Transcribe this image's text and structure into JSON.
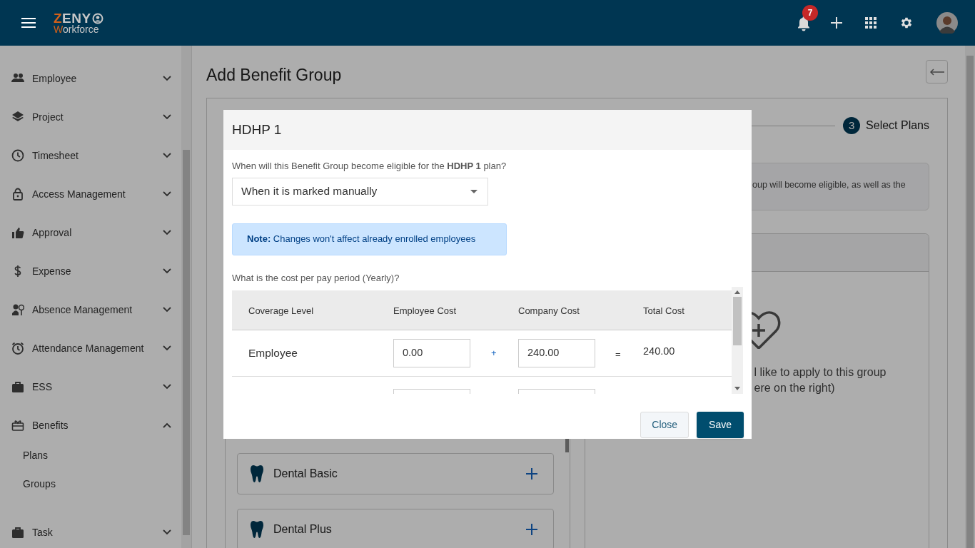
{
  "header": {
    "brand": {
      "accent": "Z",
      "rest": "ENY"
    },
    "tagline": {
      "accent": "W",
      "rest": "orkforce"
    },
    "notification_count": "7"
  },
  "sidebar": {
    "items": [
      {
        "label": "Employee",
        "expanded": false
      },
      {
        "label": "Project",
        "expanded": false
      },
      {
        "label": "Timesheet",
        "expanded": false
      },
      {
        "label": "Access Management",
        "expanded": false
      },
      {
        "label": "Approval",
        "expanded": false
      },
      {
        "label": "Expense",
        "expanded": false
      },
      {
        "label": "Absence Management",
        "expanded": false
      },
      {
        "label": "Attendance Management",
        "expanded": false
      },
      {
        "label": "ESS",
        "expanded": false
      },
      {
        "label": "Benefits",
        "expanded": true,
        "children": [
          {
            "label": "Plans"
          },
          {
            "label": "Groups"
          }
        ]
      },
      {
        "label": "Task",
        "expanded": false
      }
    ]
  },
  "page": {
    "title": "Add Benefit Group",
    "stepper": {
      "number": "3",
      "label": "Select Plans"
    },
    "info_text": "oup will become eligible, as well as the",
    "plans": [
      {
        "name": "Dental Basic"
      },
      {
        "name": "Dental Plus"
      }
    ],
    "empty_state": [
      "l like to apply to this group",
      "ere on the right)"
    ]
  },
  "modal": {
    "title": "HDHP 1",
    "question": "When will this Benefit Group become eligible for the **HDHP 1** plan?",
    "eligibility": {
      "value": "When it is marked manually"
    },
    "note": "**Note:** Changes won't affect already enrolled employees",
    "cost_label": "What is the cost per pay period (Yearly)?",
    "table": {
      "columns": [
        "Coverage Level",
        "Employee Cost",
        "Company Cost",
        "Total Cost"
      ],
      "rows": [
        {
          "kind": "full",
          "coverage_level": "Employee",
          "employee_cost": "0.00",
          "plus": "+",
          "company_cost": "240.00",
          "equals": "=",
          "total_cost": "240.00"
        },
        {
          "kind": "partial"
        }
      ]
    },
    "buttons": [
      {
        "label": "Close",
        "kind": "secondary"
      },
      {
        "label": "Save",
        "kind": "primary"
      }
    ]
  }
}
